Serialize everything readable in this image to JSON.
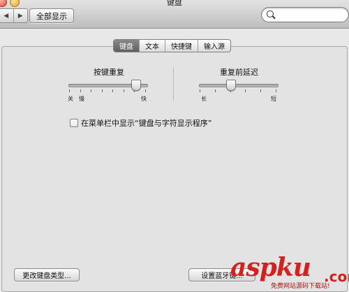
{
  "window": {
    "title": "键盘"
  },
  "toolbar": {
    "back_glyph": "◀",
    "forward_glyph": "▶",
    "show_all_label": "全部显示",
    "search_value": "",
    "search_icon": "search-icon"
  },
  "tabs": [
    {
      "label": "键盘",
      "active": true
    },
    {
      "label": "文本",
      "active": false
    },
    {
      "label": "快捷键",
      "active": false
    },
    {
      "label": "输入源",
      "active": false
    }
  ],
  "key_repeat": {
    "title": "按键重复",
    "min_label": "关",
    "slow_label": "慢",
    "max_label": "快",
    "value_fraction": 0.86
  },
  "delay_until_repeat": {
    "title": "重复前延迟",
    "min_label": "长",
    "max_label": "短",
    "value_fraction": 0.4
  },
  "show_in_menu_bar": {
    "label": "在菜单栏中显示“键盘与字符显示程序”",
    "checked": false
  },
  "buttons": {
    "change_keyboard_type": "更改键盘类型...",
    "setup_bluetooth_keyboard": "设置蓝牙键..."
  },
  "watermark": {
    "logo_text": "aspku",
    "dot_text": ".com",
    "subtitle": "免费网站源码下载站!"
  },
  "colors": {
    "active_tab_bg": "#6f6f6f",
    "watermark_red": "#d6201e"
  }
}
